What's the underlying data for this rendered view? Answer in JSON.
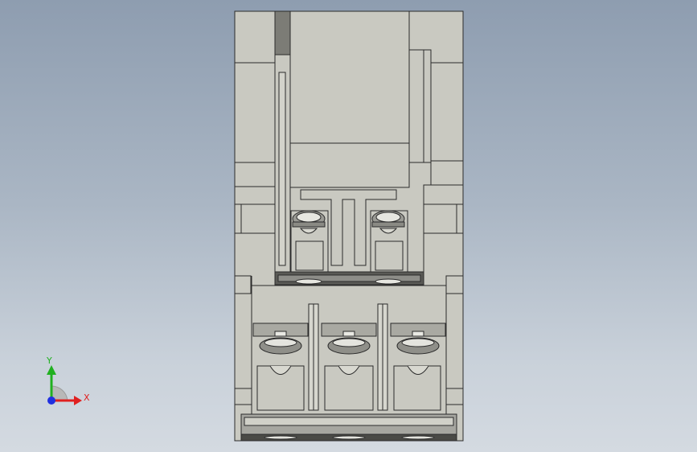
{
  "viewport": {
    "background_top": "#8e9db0",
    "background_bottom": "#d4dae1",
    "part_fill": "#c9c9c1",
    "part_stroke": "#2b2b2b",
    "shadow_fill": "#6f6f6a"
  },
  "triad": {
    "x_label": "X",
    "y_label": "Y",
    "x_color": "#e02020",
    "y_color": "#20b020",
    "z_color": "#2030e0"
  }
}
